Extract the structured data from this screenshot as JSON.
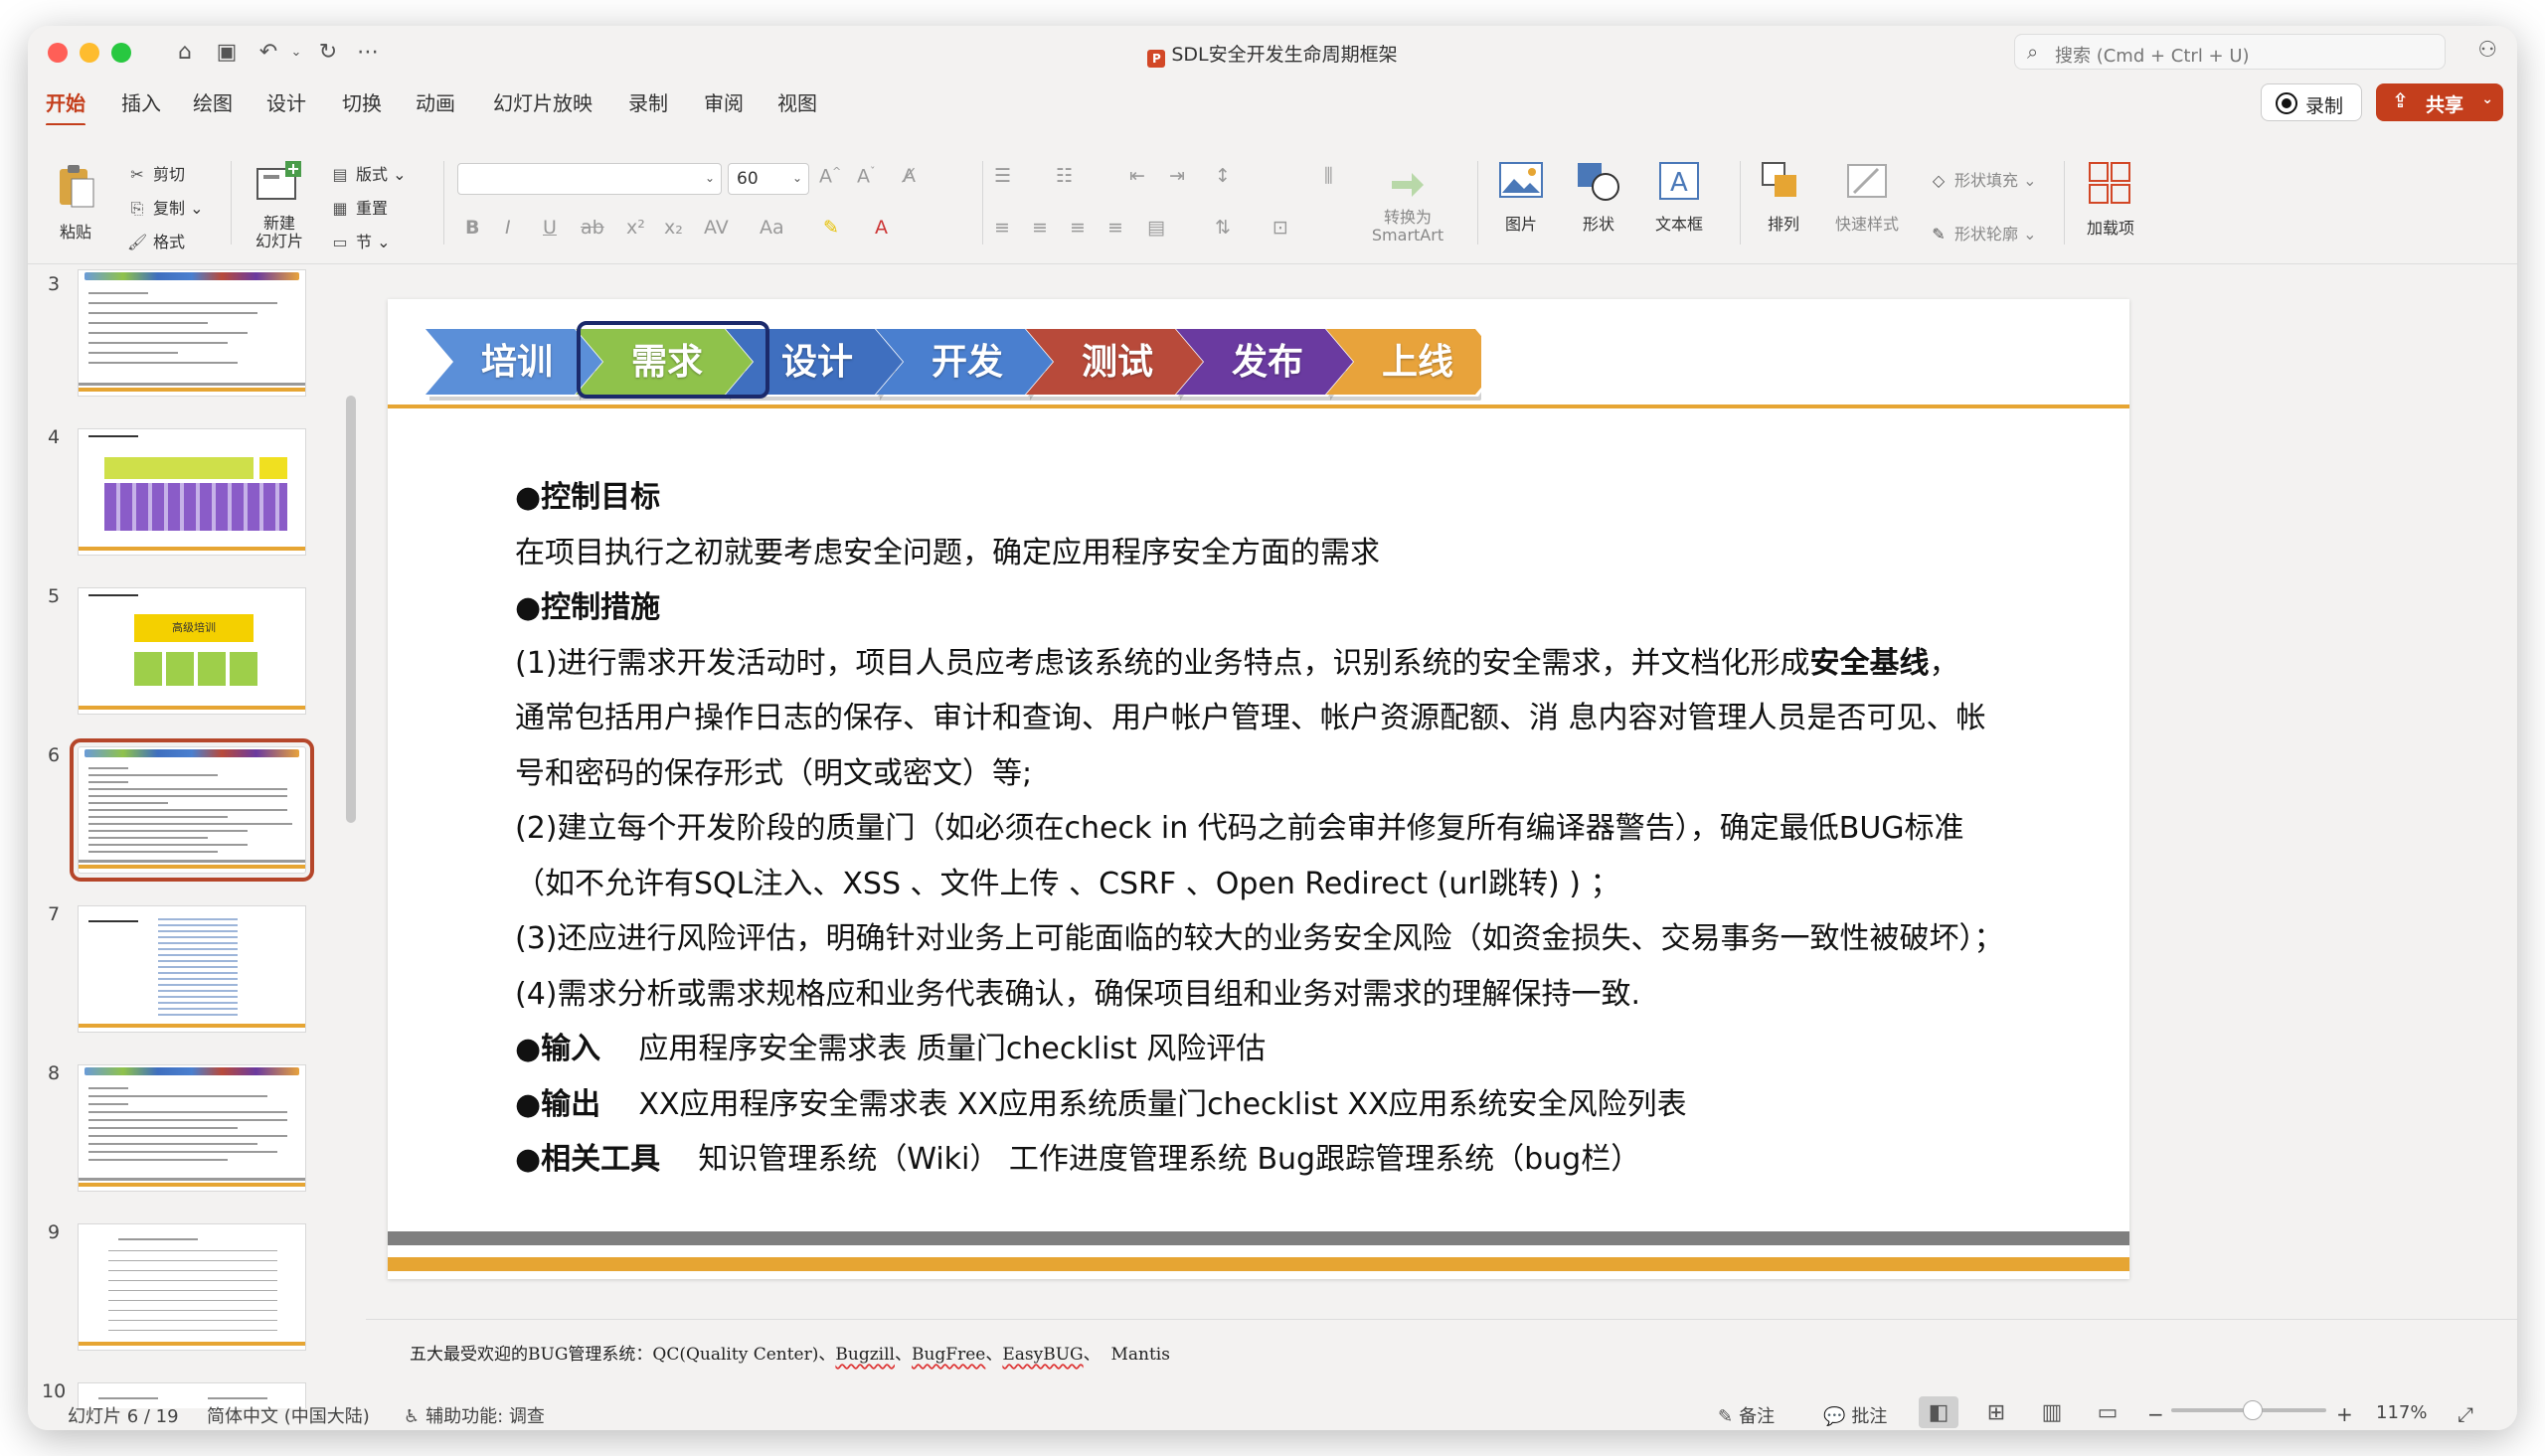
{
  "window": {
    "title": "SDL安全开发生命周期框架",
    "search_placeholder": "搜索 (Cmd + Ctrl + U)"
  },
  "quick_access": [
    "home-icon",
    "save-icon",
    "undo-icon",
    "redo-icon",
    "more-icon"
  ],
  "menu": {
    "tabs": [
      "开始",
      "插入",
      "绘图",
      "设计",
      "切换",
      "动画",
      "幻灯片放映",
      "录制",
      "审阅",
      "视图"
    ],
    "active": "开始",
    "record_label": "录制",
    "share_label": "共享"
  },
  "ribbon": {
    "paste": "粘贴",
    "cut": "剪切",
    "copy": "复制",
    "format": "格式",
    "new_slide": "新建\n幻灯片",
    "layout": "版式",
    "reset": "重置",
    "section": "节",
    "font_name": "",
    "font_size": "60",
    "convert_smartart": "转换为\nSmartArt",
    "picture": "图片",
    "shape": "形状",
    "textbox": "文本框",
    "arrange": "排列",
    "quick_styles": "快速样式",
    "shape_fill": "形状填充",
    "shape_outline": "形状轮廓",
    "addins": "加载项"
  },
  "thumbnails": {
    "numbers": [
      "3",
      "4",
      "5",
      "6",
      "7",
      "8",
      "9",
      "10"
    ],
    "active": "6",
    "slide5_box": "高级培训"
  },
  "slide": {
    "steps": [
      {
        "label": "培训",
        "color": "#5b8fd8"
      },
      {
        "label": "需求",
        "color": "#8fc24b"
      },
      {
        "label": "设计",
        "color": "#3f6fbf"
      },
      {
        "label": "开发",
        "color": "#4a7fcf"
      },
      {
        "label": "测试",
        "color": "#b84a3a"
      },
      {
        "label": "发布",
        "color": "#6a3aa0"
      },
      {
        "label": "上线",
        "color": "#e8a33b"
      }
    ],
    "active_step": "需求",
    "lines": {
      "h_goal": "●控制目标",
      "goal": "在项目执行之初就要考虑安全问题，确定应用程序安全方面的需求",
      "h_measures": "●控制措施",
      "m1_a": "(1)进行需求开发活动时，项目人员应考虑该系统的业务特点，识别系统的安全需求，并文档化形成",
      "m1_bold": "安全基线",
      "m1_end": "，",
      "m1_b": "通常包括用户操作日志的保存、审计和查询、用户帐户管理、帐户资源配额、消 息内容对管理人员是否可见、帐",
      "m1_c": "号和密码的保存形式（明文或密文）等;",
      "m2_a": "(2)建立每个开发阶段的质量门（如必须在check in 代码之前会审并修复所有编译器警告），确定最低BUG标准",
      "m2_b": "（如不允许有SQL注入、XSS 、文件上传 、CSRF 、Open Redirect (url跳转) ) ；",
      "m3": "(3)还应进行风险评估，明确针对业务上可能面临的较大的业务安全风险（如资金损失、交易事务一致性被破坏）；",
      "m4": "(4)需求分析或需求规格应和业务代表确认，确保项目组和业务对需求的理解保持一致.",
      "input_h": "●输入",
      "input_v": "应用程序安全需求表   质量门checklist  风险评估",
      "output_h": "●输出",
      "output_v": "XX应用程序安全需求表   XX应用系统质量门checklist  XX应用系统安全风险列表",
      "tools_h": "●相关工具",
      "tools_v": "知识管理系统（Wiki）   工作进度管理系统  Bug跟踪管理系统（bug栏）"
    }
  },
  "notes": {
    "prefix": "五大最受欢迎的BUG管理系统：QC(Quality Center)、",
    "items": [
      "Bugzill",
      "BugFree",
      "EasyBUG"
    ],
    "sep": "、",
    "tail": "Mantis"
  },
  "status": {
    "slide_counter": "幻灯片 6 / 19",
    "language": "简体中文 (中国大陆)",
    "accessibility": "辅助功能: 调查",
    "notes_btn": "备注",
    "comments_btn": "批注",
    "zoom": "117%"
  }
}
